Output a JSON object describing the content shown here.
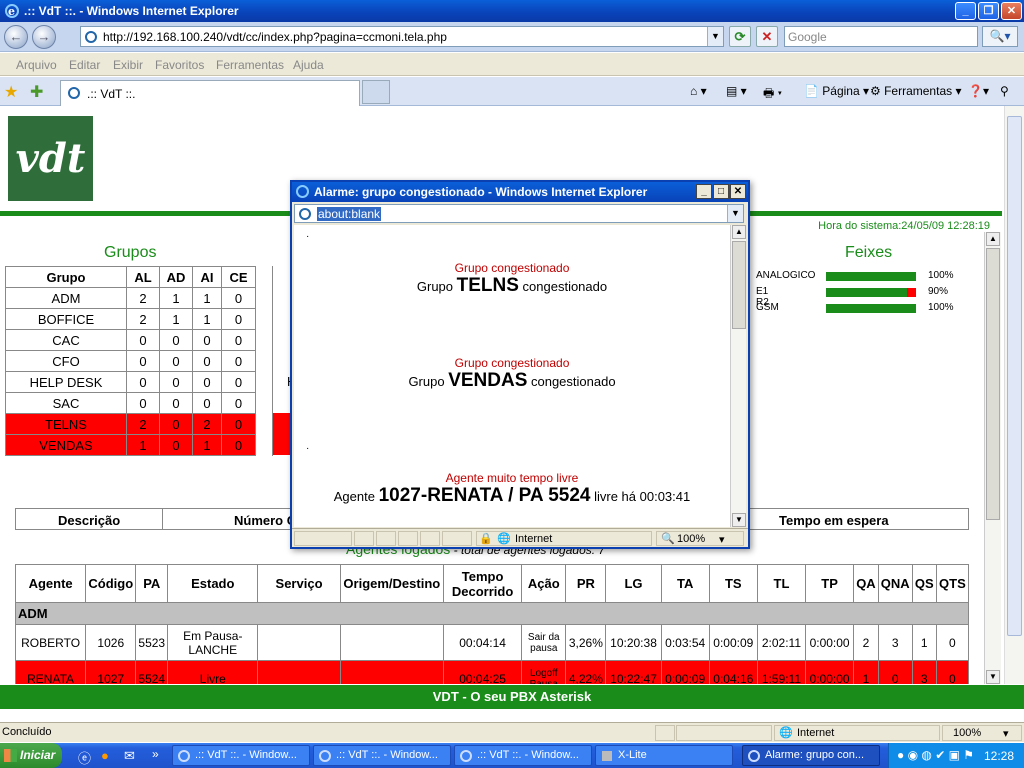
{
  "window": {
    "title": ".:: VdT ::. - Windows Internet Explorer",
    "url": "http://192.168.100.240/vdt/cc/index.php?pagina=ccmoni.tela.php",
    "search_placeholder": "Google",
    "menu": [
      "Arquivo",
      "Editar",
      "Exibir",
      "Favoritos",
      "Ferramentas",
      "Ajuda"
    ],
    "tab_title": ".:: VdT ::.",
    "cmd_pagina": "Página",
    "cmd_ferramentas": "Ferramentas",
    "status_text": "Concluído",
    "status_zone": "Internet",
    "status_zoom": "100%"
  },
  "page": {
    "logo": "vdt",
    "system_time": "Hora do sistema:24/05/09 12:28:19",
    "groups_title": "Grupos",
    "groups_headers": [
      "Grupo",
      "AL",
      "AD",
      "AI",
      "CE"
    ],
    "groups": [
      {
        "name": "ADM",
        "al": "2",
        "ad": "1",
        "ai": "1",
        "ce": "0",
        "alarm": false
      },
      {
        "name": "BOFFICE",
        "al": "2",
        "ad": "1",
        "ai": "1",
        "ce": "0",
        "alarm": false
      },
      {
        "name": "CAC",
        "al": "0",
        "ad": "0",
        "ai": "0",
        "ce": "0",
        "alarm": false
      },
      {
        "name": "CFO",
        "al": "0",
        "ad": "0",
        "ai": "0",
        "ce": "0",
        "alarm": false
      },
      {
        "name": "HELP DESK",
        "al": "0",
        "ad": "0",
        "ai": "0",
        "ce": "0",
        "alarm": false
      },
      {
        "name": "SAC",
        "al": "0",
        "ad": "0",
        "ai": "0",
        "ce": "0",
        "alarm": false
      },
      {
        "name": "TELNS",
        "al": "2",
        "ad": "0",
        "ai": "2",
        "ce": "0",
        "alarm": true
      },
      {
        "name": "VENDAS",
        "al": "1",
        "ad": "0",
        "ai": "1",
        "ce": "0",
        "alarm": true
      }
    ],
    "partial_h": "H",
    "feixes_title": "Feixes",
    "feixes": [
      {
        "name": "ANALOGICO",
        "pct": "100%",
        "usage": 1.0
      },
      {
        "name": "E1 R2",
        "pct": "90%",
        "usage": 0.9
      },
      {
        "name": "GSM",
        "pct": "100%",
        "usage": 1.0
      }
    ],
    "calls_headers": {
      "descricao": "Descrição",
      "numero": "Número C",
      "espera": "Tempo em espera"
    },
    "agents_title": "Agentes logados",
    "agents_total": " - total de agentes logados: 7",
    "agents_headers": [
      "Agente",
      "Código",
      "PA",
      "Estado",
      "Serviço",
      "Origem/Destino",
      "Tempo Decorrido",
      "Ação",
      "PR",
      "LG",
      "TA",
      "TS",
      "TL",
      "TP",
      "QA",
      "QNA",
      "QS",
      "QTS"
    ],
    "agent_group": "ADM",
    "agents": [
      {
        "agente": "ROBERTO",
        "codigo": "1026",
        "pa": "5523",
        "estado": "Em Pausa-LANCHE",
        "servico": "",
        "origem": "",
        "tempo": "00:04:14",
        "acao": "Sair da pausa",
        "pr": "3,26%",
        "lg": "10:20:38",
        "ta": "0:03:54",
        "ts": "0:00:09",
        "tl": "2:02:11",
        "tp": "0:00:00",
        "qa": "2",
        "qna": "3",
        "qs": "1",
        "qts": "0",
        "red": false
      },
      {
        "agente": "RENATA",
        "codigo": "1027",
        "pa": "5524",
        "estado": "Livre",
        "servico": "",
        "origem": "",
        "tempo": "00:04:25",
        "acao": "Logoff Pausa",
        "pr": "4,22%",
        "lg": "10:22:47",
        "ta": "0:00:09",
        "ts": "0:04:16",
        "tl": "1:59:11",
        "tp": "0:00:00",
        "qa": "1",
        "qna": "0",
        "qs": "3",
        "qts": "0",
        "red": true
      }
    ],
    "footer": "VDT - O seu PBX Asterisk"
  },
  "popup": {
    "title": "Alarme: grupo congestionado - Windows Internet Explorer",
    "url": "about:blank",
    "alerts": [
      {
        "type": "Grupo congestionado",
        "prefix": "Grupo ",
        "name": "TELNS",
        "suffix": " congestionado"
      },
      {
        "type": "Grupo congestionado",
        "prefix": "Grupo ",
        "name": "VENDAS",
        "suffix": " congestionado"
      },
      {
        "type": "Agente muito tempo livre",
        "prefix": "Agente ",
        "name": "1027-RENATA / PA 5524",
        "suffix": " livre há 00:03:41"
      }
    ],
    "status_zone": "Internet",
    "status_zoom": "100%"
  },
  "taskbar": {
    "start": "Iniciar",
    "buttons": [
      ".:: VdT ::. - Window...",
      ".:: VdT ::. - Window...",
      ".:: VdT ::. - Window...",
      "X-Lite",
      "Alarme: grupo con..."
    ],
    "clock": "12:28"
  },
  "colors": {
    "green": "#1a8c1a",
    "alarm_red": "#ff0000",
    "title_blue": "#0a5fd8"
  }
}
